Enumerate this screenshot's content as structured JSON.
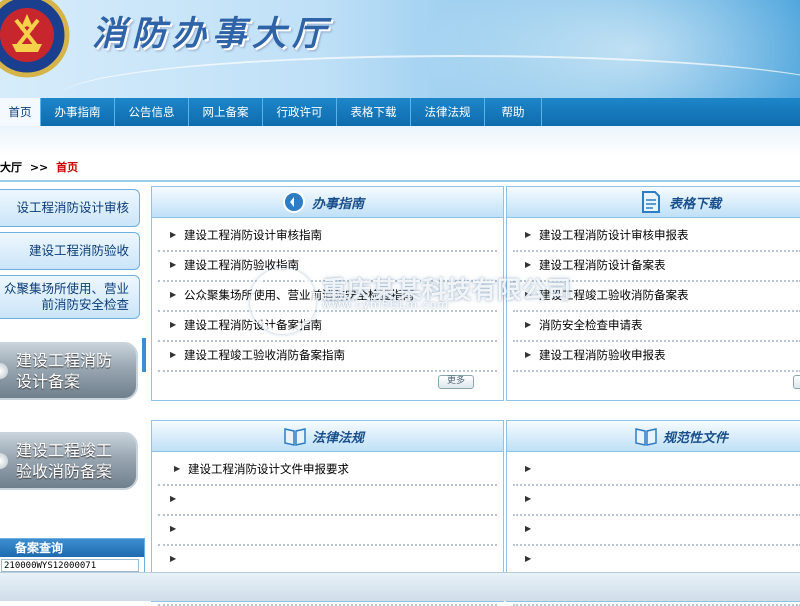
{
  "header": {
    "site_title": "消防办事大厅"
  },
  "nav": {
    "items": [
      {
        "label": "首页",
        "active": true
      },
      {
        "label": "办事指南",
        "active": false
      },
      {
        "label": "公告信息",
        "active": false
      },
      {
        "label": "网上备案",
        "active": false
      },
      {
        "label": "行政许可",
        "active": false
      },
      {
        "label": "表格下载",
        "active": false
      },
      {
        "label": "法律法规",
        "active": false
      },
      {
        "label": "帮助",
        "active": false
      }
    ]
  },
  "breadcrumb": {
    "parent": "大厅",
    "separator": ">>",
    "current": "首页"
  },
  "left": {
    "buttons": [
      {
        "label": "设工程消防设计审核"
      },
      {
        "label": "建设工程消防验收"
      },
      {
        "label": "众聚集场所使用、营业前消防安全检查"
      }
    ],
    "big_buttons": [
      {
        "label": "建设工程消防设计备案"
      },
      {
        "label": "建设工程竣工验收消防备案"
      }
    ],
    "query": {
      "title": "备案查询",
      "value": "210000WYS12000071"
    }
  },
  "panels": {
    "guide": {
      "title": "办事指南",
      "items": [
        "建设工程消防设计审核指南",
        "建设工程消防验收指南",
        "公众聚集场所使用、营业前消防安全检查指南",
        "建设工程消防设计备案指南",
        "建设工程竣工验收消防备案指南"
      ],
      "more": "更多"
    },
    "forms": {
      "title": "表格下载",
      "items": [
        "建设工程消防设计审核申报表",
        "建设工程消防设计备案表",
        "建设工程竣工验收消防备案表",
        "消防安全检查申请表",
        "建设工程消防验收申报表"
      ]
    },
    "law": {
      "title": "法律法规",
      "items": [
        "建设工程消防设计文件申报要求",
        "",
        "",
        "",
        ""
      ]
    },
    "norms": {
      "title": "规范性文件",
      "items": [
        "",
        "",
        "",
        "",
        ""
      ]
    }
  },
  "watermark": {
    "text": "重庆某某科技有限公司",
    "url": "www.cym5GLm.com"
  },
  "colors": {
    "nav_bg": "#0e6cae",
    "accent": "#1a4f8c",
    "current": "#cc0000"
  }
}
